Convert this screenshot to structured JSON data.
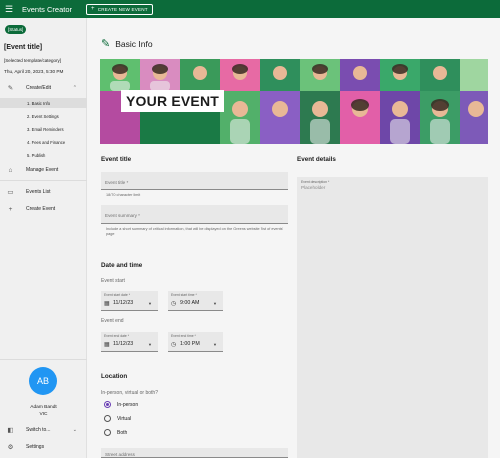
{
  "appbar": {
    "menu_icon": "menu-icon",
    "title": "Events Creator",
    "create_button": "CREATE NEW EVENT"
  },
  "sidebar": {
    "status": "[Status]",
    "event_title": "[Event title]",
    "template": "[Selected template/category]",
    "date": "Thu, April 20, 2023, 5:30 PM",
    "nav": {
      "create_edit": "Create/Edit",
      "steps": [
        "1. Basic Info",
        "2. Event Settings",
        "3. Email Reminders",
        "4. Fees and Finance",
        "5. Publish"
      ],
      "manage_event": "Manage Event",
      "events_list": "Events List",
      "create_event": "Create Event"
    },
    "user": {
      "initials": "AB",
      "name": "Adam Bandt",
      "region": "VIC"
    },
    "switch_to": "Switch to...",
    "settings": "Settings"
  },
  "main": {
    "page_title": "Basic Info",
    "banner_text": "YOUR EVENT",
    "event_title_section": "Event title",
    "event_title_label": "Event title *",
    "char_limit": "18/70 character limit",
    "summary_label": "Event summary *",
    "summary_helper": "Include a short summary of critical information, that will be displayed on the Greens website 'list of events' page",
    "event_details_section": "Event details",
    "description_label": "Event description *",
    "description_placeholder": "Placeholder",
    "date_time_section": "Date and time",
    "event_start": "Event start",
    "start_date_label": "Event start date *",
    "start_date_value": "11/12/23",
    "start_time_label": "Event start time *",
    "start_time_value": "9:00 AM",
    "event_end": "Event end",
    "end_date_label": "Event end date *",
    "end_date_value": "11/12/23",
    "end_time_label": "Event end time *",
    "end_time_value": "1:00 PM",
    "location_section": "Location",
    "location_question": "In-person, virtual or both?",
    "location_options": [
      "In-person",
      "Virtual",
      "Both"
    ],
    "location_selected": "In-person",
    "street_address_label": "Street address"
  },
  "colors": {
    "brand_green": "#0c6b3a",
    "radio_purple": "#6a3fb5",
    "avatar_blue": "#2196f3"
  }
}
